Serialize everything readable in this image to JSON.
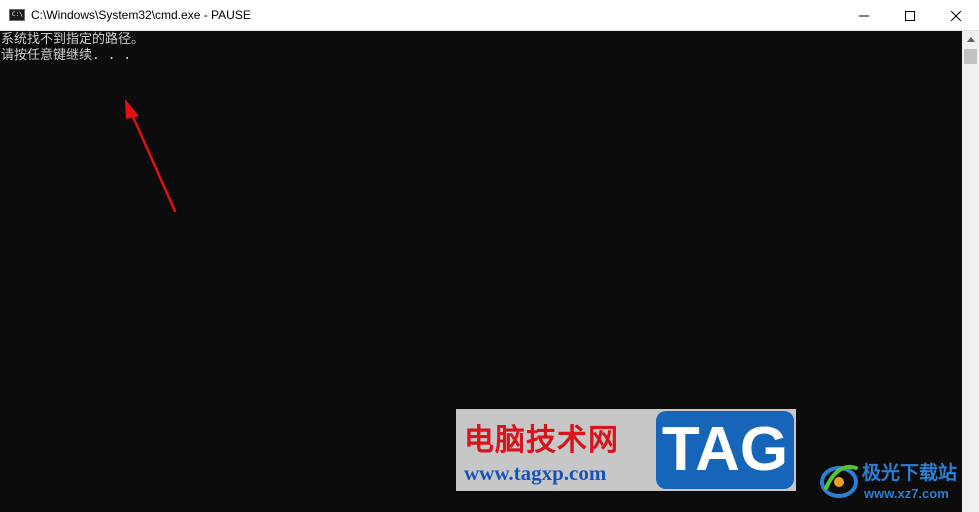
{
  "window": {
    "title": "C:\\Windows\\System32\\cmd.exe - PAUSE",
    "icon": "console-icon",
    "icon_text": "C:\\",
    "controls": [
      "minimize-icon",
      "maximize-icon",
      "close-icon"
    ]
  },
  "console": {
    "lines": [
      "系统找不到指定的路径。",
      "请按任意键继续. . ."
    ],
    "background": "#0c0c0c",
    "foreground": "#cccccc"
  },
  "annotation": {
    "icon": "arrow-icon",
    "color": "#e01010"
  },
  "watermark_1": {
    "title": "电脑技术网",
    "url": "www.tagxp.com",
    "badge": "TAG"
  },
  "watermark_2": {
    "title": "极光下载站",
    "url": "www.xz7.com",
    "icon": "aurora-logo-icon"
  }
}
